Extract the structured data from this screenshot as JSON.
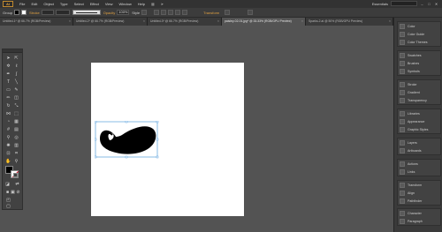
{
  "app": {
    "logo": "Ai"
  },
  "menu": {
    "items": [
      "File",
      "Edit",
      "Object",
      "Type",
      "Select",
      "Effect",
      "View",
      "Window",
      "Help"
    ]
  },
  "workspace": {
    "label": "Essentials"
  },
  "window_controls": {
    "minimize": "–",
    "maximize": "□",
    "close": "✕"
  },
  "controlbar": {
    "selection_label": "Group",
    "stroke_label": "Stroke",
    "opacity_label": "Opacity",
    "opacity_value": "100%",
    "style_label": "Style",
    "transform_label": "Transform"
  },
  "tabs": [
    {
      "label": "Untitled-1* @ 66.7% (RGB/Preview)",
      "close": "×",
      "active": false
    },
    {
      "label": "Untitled-2* @ 66.7% (RGB/Preview)",
      "close": "×",
      "active": false
    },
    {
      "label": "Untitled-3* @ 66.7% (RGB/Preview)",
      "close": "×",
      "active": false
    },
    {
      "label": "paisley-02-01.jpg* @ 33.33% (RGB/GPU Preview)",
      "close": "×",
      "active": true
    },
    {
      "label": "Sparks-2.ai @ 50% (RGB/GPU Preview)",
      "close": "×",
      "active": false
    }
  ],
  "panels": {
    "group1": [
      "Color",
      "Color Guide",
      "Color Themes"
    ],
    "group2": [
      "Swatches",
      "Brushes",
      "Symbols"
    ],
    "group3": [
      "Stroke",
      "Gradient",
      "Transparency"
    ],
    "group4": [
      "Libraries",
      "Appearance",
      "Graphic Styles"
    ],
    "group5": [
      "Layers",
      "Artboards"
    ],
    "group6": [
      "Actions",
      "Links"
    ],
    "group7": [
      "Transform",
      "Align",
      "Pathfinder"
    ],
    "group8": [
      "Character",
      "Paragraph",
      "OpenType"
    ]
  },
  "colors": {
    "fill": "#000000",
    "stroke": "#ffffff",
    "selection": "#3a8fd6"
  }
}
